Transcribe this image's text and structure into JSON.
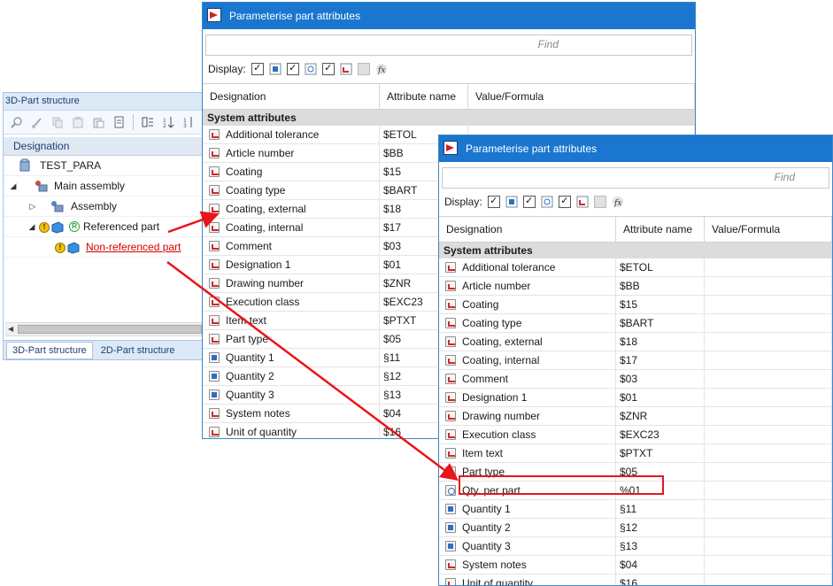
{
  "tree_panel": {
    "title": "3D-Part structure",
    "column_header": "Designation",
    "items": [
      {
        "label": "TEST_PARA",
        "icon": "part-file-icon"
      },
      {
        "label": "Main assembly",
        "icon": "assembly-icon"
      },
      {
        "label": "Assembly",
        "icon": "assembly-icon"
      },
      {
        "label": "Referenced part",
        "icon": "part-icon",
        "badge": "R"
      },
      {
        "label": "Non-referenced part",
        "icon": "part-icon"
      }
    ],
    "warning_symbol": "!",
    "tabs": [
      "3D-Part structure",
      "2D-Part structure"
    ],
    "active_tab": "3D-Part structure"
  },
  "dialog_back": {
    "title": "Parameterise part attributes",
    "find_placeholder": "Find",
    "display_label": "Display:",
    "columns": [
      "Designation",
      "Attribute name",
      "Value/Formula"
    ],
    "group": "System attributes",
    "rows": [
      {
        "designation": "Additional tolerance",
        "attribute": "$ETOL",
        "icon": "text"
      },
      {
        "designation": "Article number",
        "attribute": "$BB",
        "icon": "text"
      },
      {
        "designation": "Coating",
        "attribute": "$15",
        "icon": "text"
      },
      {
        "designation": "Coating type",
        "attribute": "$BART",
        "icon": "text"
      },
      {
        "designation": "Coating, external",
        "attribute": "$18",
        "icon": "text"
      },
      {
        "designation": "Coating, internal",
        "attribute": "$17",
        "icon": "text"
      },
      {
        "designation": "Comment",
        "attribute": "$03",
        "icon": "text"
      },
      {
        "designation": "Designation 1",
        "attribute": "$01",
        "icon": "text"
      },
      {
        "designation": "Drawing number",
        "attribute": "$ZNR",
        "icon": "text"
      },
      {
        "designation": "Execution class",
        "attribute": "$EXC23",
        "icon": "text"
      },
      {
        "designation": "Item text",
        "attribute": "$PTXT",
        "icon": "text"
      },
      {
        "designation": "Part type",
        "attribute": "$05",
        "icon": "text"
      },
      {
        "designation": "Quantity 1",
        "attribute": "§11",
        "icon": "num"
      },
      {
        "designation": "Quantity 2",
        "attribute": "§12",
        "icon": "num"
      },
      {
        "designation": "Quantity 3",
        "attribute": "§13",
        "icon": "num"
      },
      {
        "designation": "System notes",
        "attribute": "$04",
        "icon": "text"
      },
      {
        "designation": "Unit of quantity",
        "attribute": "$16",
        "icon": "text"
      }
    ]
  },
  "dialog_front": {
    "title": "Parameterise part attributes",
    "find_placeholder": "Find",
    "display_label": "Display:",
    "columns": [
      "Designation",
      "Attribute name",
      "Value/Formula"
    ],
    "group": "System attributes",
    "rows": [
      {
        "designation": "Additional tolerance",
        "attribute": "$ETOL",
        "icon": "text"
      },
      {
        "designation": "Article number",
        "attribute": "$BB",
        "icon": "text"
      },
      {
        "designation": "Coating",
        "attribute": "$15",
        "icon": "text"
      },
      {
        "designation": "Coating type",
        "attribute": "$BART",
        "icon": "text"
      },
      {
        "designation": "Coating, external",
        "attribute": "$18",
        "icon": "text"
      },
      {
        "designation": "Coating, internal",
        "attribute": "$17",
        "icon": "text"
      },
      {
        "designation": "Comment",
        "attribute": "$03",
        "icon": "text"
      },
      {
        "designation": "Designation 1",
        "attribute": "$01",
        "icon": "text"
      },
      {
        "designation": "Drawing number",
        "attribute": "$ZNR",
        "icon": "text"
      },
      {
        "designation": "Execution class",
        "attribute": "$EXC23",
        "icon": "text"
      },
      {
        "designation": "Item text",
        "attribute": "$PTXT",
        "icon": "text"
      },
      {
        "designation": "Part type",
        "attribute": "$05",
        "icon": "text"
      },
      {
        "designation": "Qty. per part",
        "attribute": "%01",
        "icon": "formula",
        "highlighted": true
      },
      {
        "designation": "Quantity 1",
        "attribute": "§11",
        "icon": "num"
      },
      {
        "designation": "Quantity 2",
        "attribute": "§12",
        "icon": "num"
      },
      {
        "designation": "Quantity 3",
        "attribute": "§13",
        "icon": "num"
      },
      {
        "designation": "System notes",
        "attribute": "$04",
        "icon": "text"
      },
      {
        "designation": "Unit of quantity",
        "attribute": "$16",
        "icon": "text"
      }
    ]
  },
  "colors": {
    "title_bar": "#1a76cf",
    "highlight": "#e8151b",
    "non_referenced_text": "#d40000"
  }
}
